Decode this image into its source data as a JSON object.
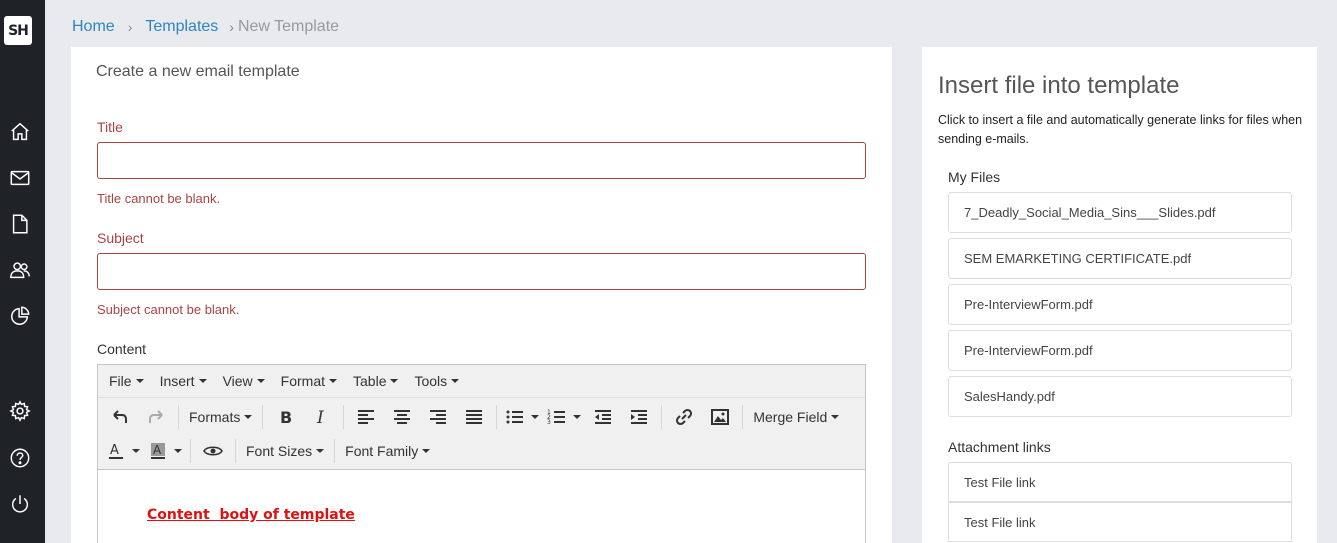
{
  "app": {
    "logo_text": "SH"
  },
  "sidebar": {
    "items": [
      {
        "name": "home",
        "icon": "home-icon"
      },
      {
        "name": "mail",
        "icon": "mail-icon"
      },
      {
        "name": "templates",
        "icon": "document-icon"
      },
      {
        "name": "contacts",
        "icon": "users-icon"
      },
      {
        "name": "reports",
        "icon": "pie-chart-icon"
      },
      {
        "name": "settings",
        "icon": "gear-icon"
      },
      {
        "name": "help",
        "icon": "help-icon"
      },
      {
        "name": "logout",
        "icon": "power-icon"
      }
    ]
  },
  "breadcrumb": {
    "home": "Home",
    "sep1": "›",
    "templates": "Templates",
    "sep2": "›",
    "current": "New Template"
  },
  "form": {
    "heading": "Create a new email template",
    "title_label": "Title",
    "title_value": "",
    "title_error": "Title cannot be blank.",
    "subject_label": "Subject",
    "subject_value": "",
    "subject_error": "Subject cannot be blank.",
    "content_label": "Content"
  },
  "editor": {
    "menu": [
      "File",
      "Insert",
      "View",
      "Format",
      "Table",
      "Tools"
    ],
    "formats_label": "Formats",
    "merge_field_label": "Merge Field",
    "font_sizes_label": "Font Sizes",
    "font_family_label": "Font Family",
    "body_text": "Content  body of template"
  },
  "side": {
    "title": "Insert file into template",
    "description": "Click to insert a file and automatically generate links for files when sending e-mails.",
    "my_files_label": "My Files",
    "files": [
      "7_Deadly_Social_Media_Sins___Slides.pdf",
      "SEM EMARKETING CERTIFICATE.pdf",
      "Pre-InterviewForm.pdf",
      "Pre-InterviewForm.pdf",
      "SalesHandy.pdf"
    ],
    "attachment_links_label": "Attachment links",
    "links": [
      "Test File link",
      "Test File link"
    ]
  },
  "colors": {
    "sidebar_bg": "#1f2328",
    "link": "#2e86c1",
    "error": "#a94442",
    "content_red": "#e01010"
  }
}
